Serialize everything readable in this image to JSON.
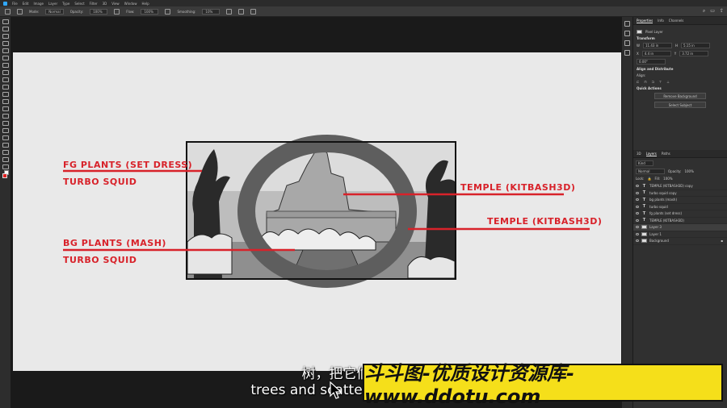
{
  "menubar": {
    "items": [
      "File",
      "Edit",
      "Image",
      "Layer",
      "Type",
      "Select",
      "Filter",
      "3D",
      "View",
      "Window",
      "Help"
    ]
  },
  "options": {
    "mode_label": "Mode:",
    "mode_value": "Normal",
    "opacity_label": "Opacity:",
    "opacity_value": "100%",
    "flow_label": "Flow:",
    "flow_value": "100%",
    "smoothing_label": "Smoothing:",
    "smoothing_value": "10%"
  },
  "panel": {
    "tabs": [
      "Properties",
      "Info",
      "Channels"
    ],
    "pixel_layer": "Pixel Layer",
    "transform_title": "Transform",
    "w_value": "11.43 in",
    "h_value": "5.15 in",
    "x_value": "4.4 in",
    "y_value": "3.72 in",
    "angle_value": "0.00°",
    "align_title": "Align and Distribute",
    "align_sub": "Align:",
    "quick_title": "Quick Actions",
    "remove_bg": "Remove Background",
    "select_subject": "Select Subject",
    "layer_tabs": [
      "3D",
      "Layers",
      "Paths"
    ],
    "kind_label": "Kind",
    "blend_value": "Normal",
    "opacity_label": "Opacity:",
    "opacity_value": "100%",
    "lock_label": "Lock:",
    "fill_label": "Fill:",
    "fill_value": "100%",
    "layers": [
      {
        "type": "T",
        "name": "TEMPLE (KITBASH3D) copy"
      },
      {
        "type": "T",
        "name": "turbo squid copy"
      },
      {
        "type": "T",
        "name": "bg plants (mash)"
      },
      {
        "type": "T",
        "name": "turbo squid"
      },
      {
        "type": "T",
        "name": "fg plants (set dress)"
      },
      {
        "type": "T",
        "name": "TEMPLE (KITBASH3D)"
      },
      {
        "type": "P",
        "name": "Layer 3"
      },
      {
        "type": "P",
        "name": "Layer 1"
      },
      {
        "type": "P",
        "name": "Background"
      }
    ]
  },
  "annotations": {
    "fg_plants": "FG PLANTS (SET DRESS)",
    "turbo1": "TURBO SQUID",
    "bg_plants": "BG PLANTS (MASH)",
    "turbo2": "TURBO SQUID",
    "temple1": "TEMPLE (KITBASH3D)",
    "temple2": "TEMPLE (KITBASH3D)"
  },
  "subtitle": {
    "cn": "树，把它们分散开现",
    "en": "trees and scatter them aroun   ow"
  },
  "watermark": "斗斗图-优质设计资源库-www.ddotu.com",
  "colors": {
    "annotation": "#d8222a",
    "watermark_bg": "#f5df1a",
    "accent": "#31a8ff"
  }
}
